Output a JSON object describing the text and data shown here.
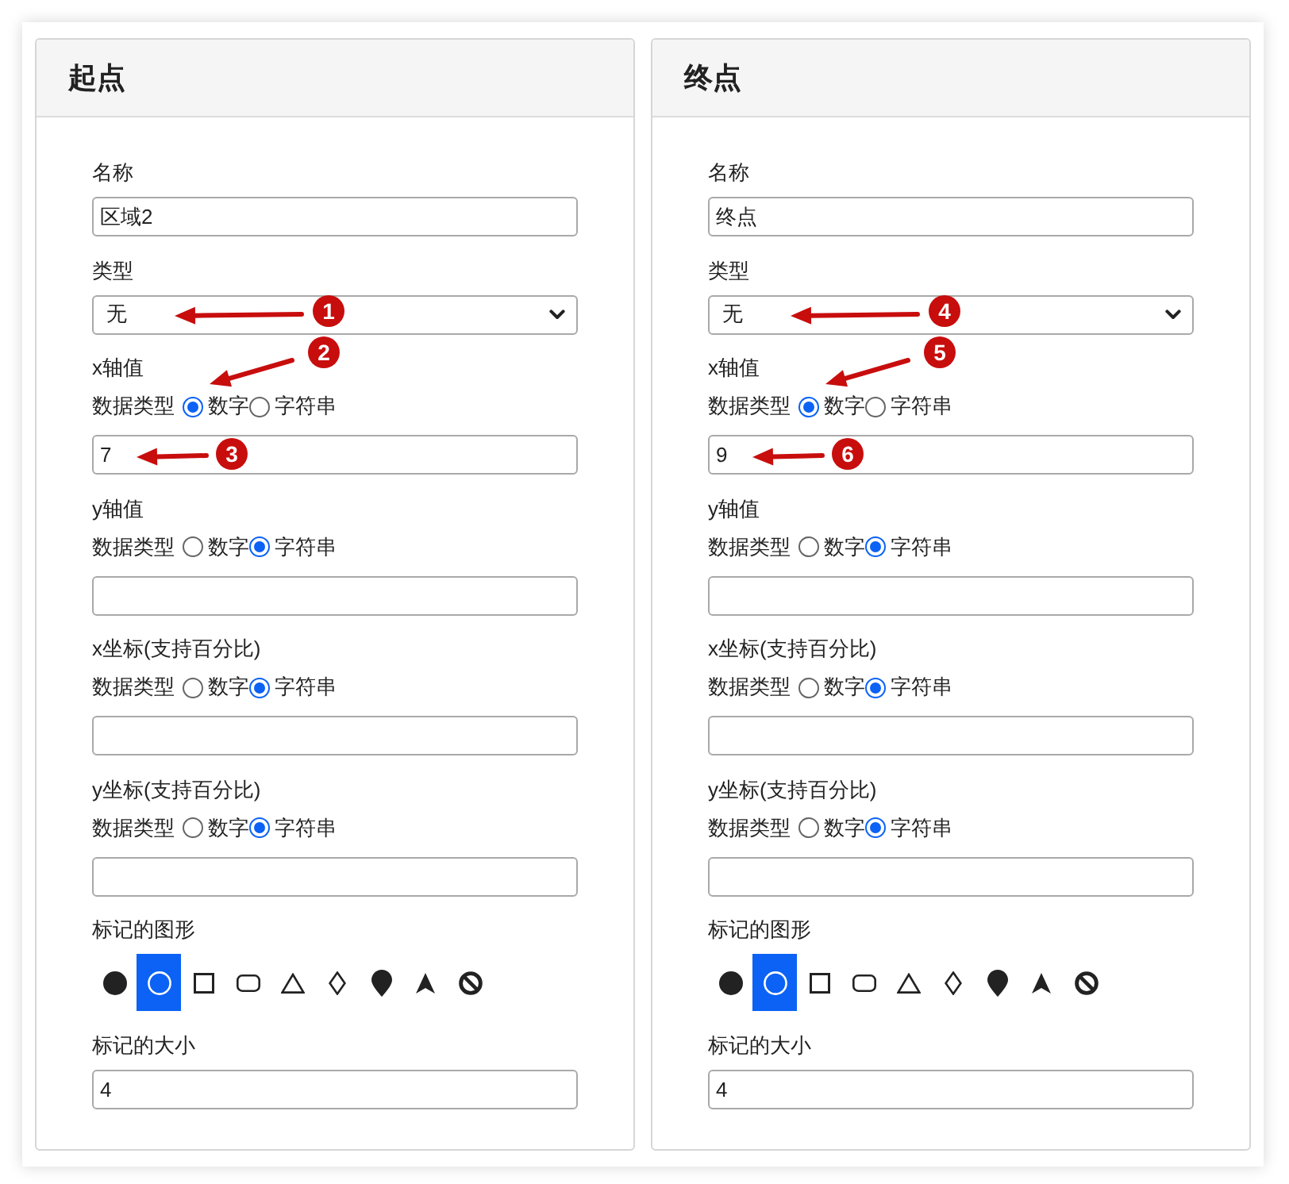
{
  "panels": [
    {
      "title": "起点",
      "fields": [
        {
          "kind": "text",
          "label": "名称",
          "value": "区域2"
        },
        {
          "kind": "select",
          "label": "类型",
          "value": "无",
          "value_callout": "1"
        },
        {
          "kind": "typed",
          "label": "x轴值",
          "data_type": {
            "label": "数据类型",
            "options": [
              {
                "label": "数字",
                "selected": true,
                "callout": "2"
              },
              {
                "label": "字符串",
                "selected": false
              }
            ],
            "value": "7",
            "value_callout": "3"
          }
        },
        {
          "kind": "typed",
          "label": "y轴值",
          "data_type": {
            "label": "数据类型",
            "options": [
              {
                "label": "数字",
                "selected": false
              },
              {
                "label": "字符串",
                "selected": true
              }
            ]
          }
        },
        {
          "kind": "typed",
          "label": "x坐标(支持百分比)",
          "data_type": {
            "label": "数据类型",
            "options": [
              {
                "label": "数字",
                "selected": false
              },
              {
                "label": "字符串",
                "selected": true
              }
            ]
          }
        },
        {
          "kind": "typed",
          "label": "y坐标(支持百分比)",
          "data_type": {
            "label": "数据类型",
            "options": [
              {
                "label": "数字",
                "selected": false
              },
              {
                "label": "字符串",
                "selected": true
              }
            ]
          }
        },
        {
          "kind": "symbols",
          "label": "标记的图形",
          "symbols": [
            {
              "kind": "filled-circle",
              "selected": false
            },
            {
              "kind": "circle",
              "selected": true
            },
            {
              "kind": "square",
              "selected": false
            },
            {
              "kind": "rounded-rectangle",
              "selected": false
            },
            {
              "kind": "triangle",
              "selected": false
            },
            {
              "kind": "diamond",
              "selected": false
            },
            {
              "kind": "pin",
              "selected": false
            },
            {
              "kind": "arrow",
              "selected": false
            },
            {
              "kind": "ban",
              "selected": false
            }
          ]
        },
        {
          "kind": "text",
          "label": "标记的大小",
          "value": "4"
        }
      ]
    },
    {
      "title": "终点",
      "fields": [
        {
          "kind": "text",
          "label": "名称",
          "value": "终点"
        },
        {
          "kind": "select",
          "label": "类型",
          "value": "无",
          "value_callout": "4"
        },
        {
          "kind": "typed",
          "label": "x轴值",
          "data_type": {
            "label": "数据类型",
            "options": [
              {
                "label": "数字",
                "selected": true,
                "callout": "5"
              },
              {
                "label": "字符串",
                "selected": false
              }
            ],
            "value": "9",
            "value_callout": "6"
          }
        },
        {
          "kind": "typed",
          "label": "y轴值",
          "data_type": {
            "label": "数据类型",
            "options": [
              {
                "label": "数字",
                "selected": false
              },
              {
                "label": "字符串",
                "selected": true
              }
            ]
          }
        },
        {
          "kind": "typed",
          "label": "x坐标(支持百分比)",
          "data_type": {
            "label": "数据类型",
            "options": [
              {
                "label": "数字",
                "selected": false
              },
              {
                "label": "字符串",
                "selected": true
              }
            ]
          }
        },
        {
          "kind": "typed",
          "label": "y坐标(支持百分比)",
          "data_type": {
            "label": "数据类型",
            "options": [
              {
                "label": "数字",
                "selected": false
              },
              {
                "label": "字符串",
                "selected": true
              }
            ]
          }
        },
        {
          "kind": "symbols",
          "label": "标记的图形",
          "symbols": [
            {
              "kind": "filled-circle",
              "selected": false
            },
            {
              "kind": "circle",
              "selected": true
            },
            {
              "kind": "square",
              "selected": false
            },
            {
              "kind": "rounded-rectangle",
              "selected": false
            },
            {
              "kind": "triangle",
              "selected": false
            },
            {
              "kind": "diamond",
              "selected": false
            },
            {
              "kind": "pin",
              "selected": false
            },
            {
              "kind": "arrow",
              "selected": false
            },
            {
              "kind": "ban",
              "selected": false
            }
          ]
        },
        {
          "kind": "text",
          "label": "标记的大小",
          "value": "4"
        }
      ]
    }
  ]
}
